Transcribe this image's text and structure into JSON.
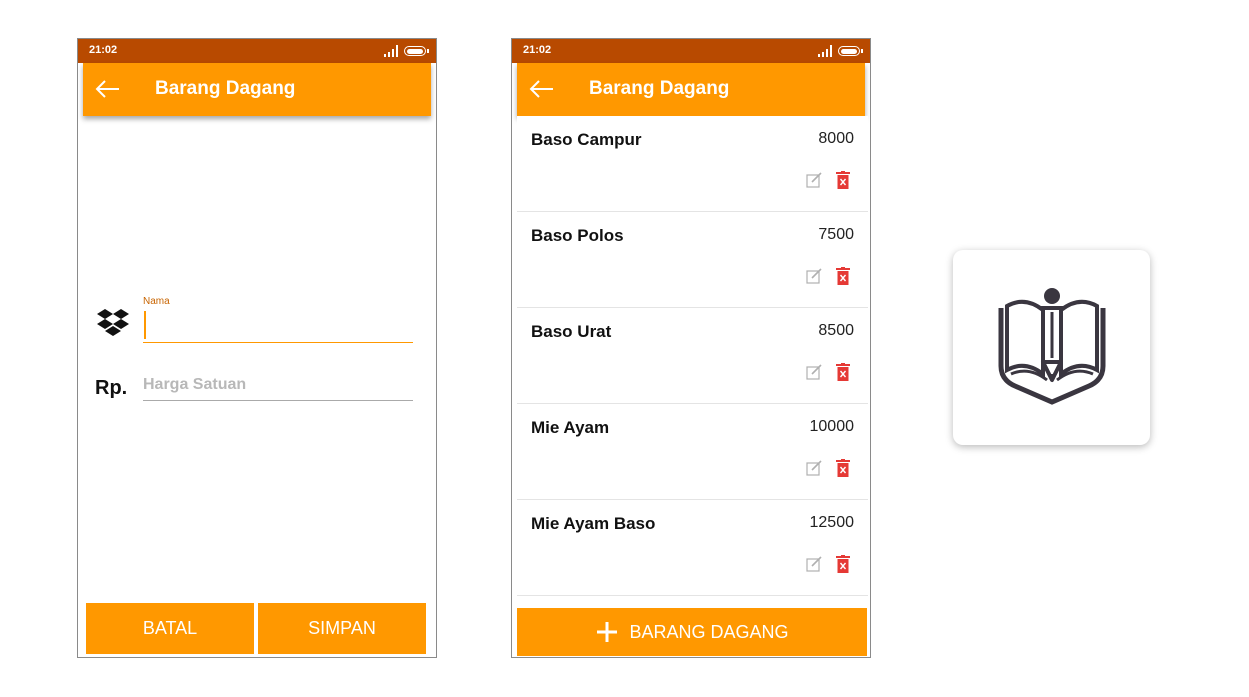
{
  "form_screen": {
    "status_time": "21:02",
    "title": "Barang Dagang",
    "name_label": "Nama",
    "name_value": "",
    "currency_label": "Rp.",
    "price_placeholder": "Harga Satuan",
    "cancel_label": "BATAL",
    "save_label": "SIMPAN",
    "icons": [
      "back-arrow-icon",
      "dropbox-icon",
      "signal-icon",
      "battery-icon"
    ]
  },
  "list_screen": {
    "status_time": "21:02",
    "title": "Barang Dagang",
    "items": [
      {
        "name": "Baso Campur",
        "price": "8000"
      },
      {
        "name": "Baso Polos",
        "price": "7500"
      },
      {
        "name": "Baso Urat",
        "price": "8500"
      },
      {
        "name": "Mie Ayam",
        "price": "10000"
      },
      {
        "name": "Mie Ayam Baso",
        "price": "12500"
      }
    ],
    "add_label": "BARANG DAGANG",
    "icons": [
      "edit-icon",
      "trash-icon",
      "plus-icon"
    ]
  },
  "colors": {
    "status_bar": "#b84a00",
    "accent": "#ff9800",
    "delete": "#e53935"
  },
  "logo": {
    "icon": "book-pencil-logo"
  }
}
